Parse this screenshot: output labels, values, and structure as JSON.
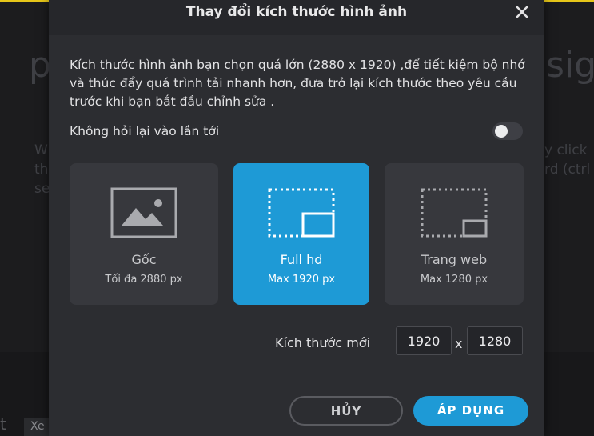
{
  "background": {
    "headline_left": "p",
    "headline_right": "sig",
    "left_lines": [
      "W",
      "th",
      "se"
    ],
    "right_lines": [
      "y click",
      "rd (ctrl"
    ],
    "footer_left": "t",
    "footer_tab": "Xe"
  },
  "dialog": {
    "title": "Thay đổi kích thước hình ảnh",
    "message": "Kích thước hình ảnh bạn chọn quá lớn (2880 x 1920) ,để tiết kiệm bộ nhớ và thúc đẩy quá trình tải nhanh hơn, đưa trở lại kích thước theo yêu cầu trước khi bạn bắt đầu chỉnh sửa .",
    "dont_ask_label": "Không hỏi lại vào lần tới",
    "dont_ask_enabled": false,
    "options": [
      {
        "title": "Gốc",
        "subtitle": "Tối đa 2880 px",
        "icon": "image-icon",
        "selected": false
      },
      {
        "title": "Full hd",
        "subtitle": "Max 1920 px",
        "icon": "resize-icon",
        "selected": true
      },
      {
        "title": "Trang web",
        "subtitle": "Max 1280 px",
        "icon": "resize-icon",
        "selected": false
      }
    ],
    "new_size_label": "Kích thước mới",
    "width_value": "1920",
    "height_value": "1280",
    "separator": "x",
    "cancel_label": "HỦY",
    "apply_label": "ÁP DỤNG"
  },
  "colors": {
    "accent": "#1e9ad6",
    "dialog_bg": "#2c2d31",
    "card_bg": "#37383d",
    "top_border": "#e6c619"
  }
}
